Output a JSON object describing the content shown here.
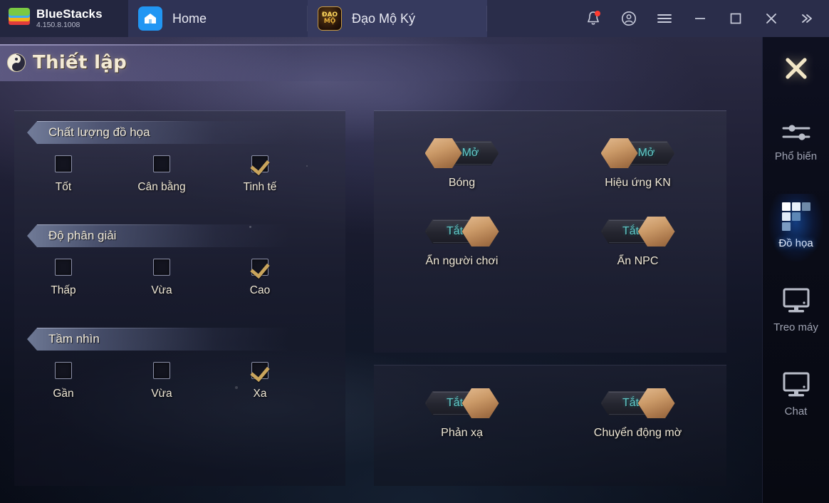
{
  "titlebar": {
    "brand": {
      "name": "BlueStacks",
      "version": "4.150.8.1008",
      "icon": "bluestacks-logo"
    },
    "tabs": [
      {
        "label": "Home",
        "icon": "home-icon"
      },
      {
        "label": "Đạo Mộ Ký",
        "icon": "game-icon",
        "icon_text_top": "ĐẠO",
        "icon_text_bottom": "MỘ"
      }
    ],
    "controls": [
      {
        "name": "notifications",
        "icon": "bell-icon",
        "badge": true
      },
      {
        "name": "account",
        "icon": "user-circle-icon"
      },
      {
        "name": "menu",
        "icon": "hamburger-icon"
      },
      {
        "name": "minimize",
        "icon": "minimize-icon"
      },
      {
        "name": "maximize",
        "icon": "maximize-icon"
      },
      {
        "name": "close",
        "icon": "close-icon"
      },
      {
        "name": "expand",
        "icon": "double-chevron-right-icon"
      }
    ]
  },
  "page": {
    "title": "Thiết lập",
    "icon": "yin-yang-icon"
  },
  "settings_groups": [
    {
      "title": "Chất lượng đồ họa",
      "options": [
        {
          "label": "Tốt",
          "checked": false
        },
        {
          "label": "Cân bằng",
          "checked": false
        },
        {
          "label": "Tinh tế",
          "checked": true
        }
      ]
    },
    {
      "title": "Độ phân giải",
      "options": [
        {
          "label": "Thấp",
          "checked": false
        },
        {
          "label": "Vừa",
          "checked": false
        },
        {
          "label": "Cao",
          "checked": true
        }
      ]
    },
    {
      "title": "Tầm nhìn",
      "options": [
        {
          "label": "Gần",
          "checked": false
        },
        {
          "label": "Vừa",
          "checked": false
        },
        {
          "label": "Xa",
          "checked": true
        }
      ]
    }
  ],
  "toggles_top": [
    {
      "label": "Bóng",
      "state": "Mở",
      "on": true
    },
    {
      "label": "Hiệu ứng KN",
      "state": "Mở",
      "on": true
    },
    {
      "label": "Ẩn người chơi",
      "state": "Tắt",
      "on": false
    },
    {
      "label": "Ẩn NPC",
      "state": "Tắt",
      "on": false
    }
  ],
  "toggles_bottom": [
    {
      "label": "Phản xạ",
      "state": "Tắt",
      "on": false
    },
    {
      "label": "Chuyển động mờ",
      "state": "Tắt",
      "on": false
    }
  ],
  "sidebar": {
    "close_icon": "close-icon",
    "items": [
      {
        "label": "Phổ biến",
        "icon": "sliders-icon",
        "active": false
      },
      {
        "label": "Đồ họa",
        "icon": "pixel-grid-icon",
        "active": true
      },
      {
        "label": "Treo máy",
        "icon": "monitor-icon",
        "active": false
      },
      {
        "label": "Chat",
        "icon": "monitor-icon",
        "active": false
      }
    ]
  },
  "colors": {
    "accent_cyan": "#63c8c8",
    "knob_bronze": "#cb9a68",
    "title_cream": "#f3ead5",
    "active_blue": "#1e78ff",
    "badge_red": "#ff3b30",
    "home_tab_blue": "#2196f3"
  }
}
